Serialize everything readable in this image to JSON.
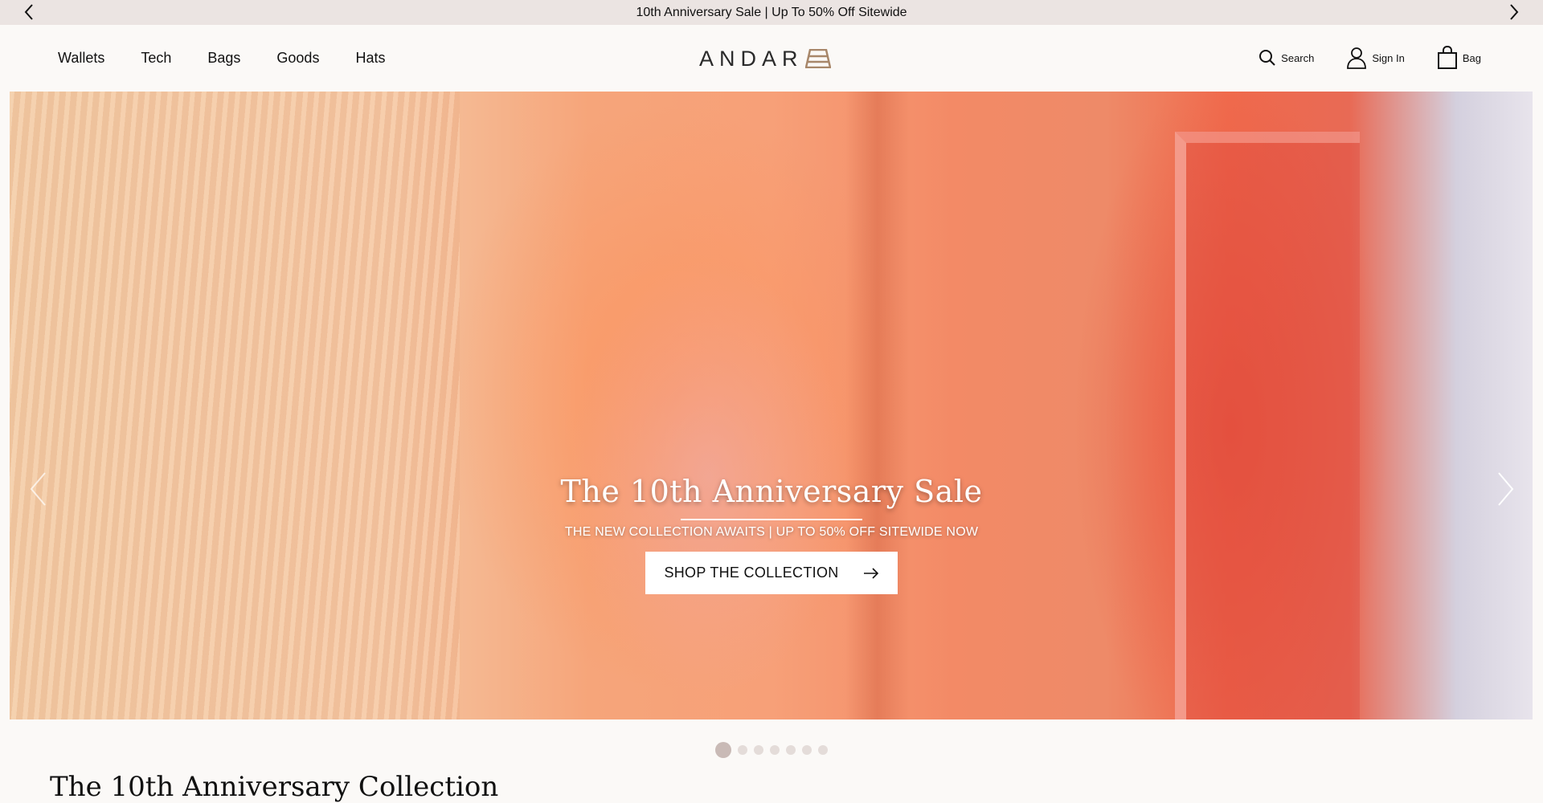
{
  "announcement": {
    "text": "10th Anniversary Sale | Up To 50% Off Sitewide",
    "prev_icon": "chevron-left-icon",
    "next_icon": "chevron-right-icon"
  },
  "nav": {
    "items": [
      {
        "label": "Wallets"
      },
      {
        "label": "Tech"
      },
      {
        "label": "Bags"
      },
      {
        "label": "Goods"
      },
      {
        "label": "Hats"
      }
    ]
  },
  "brand": {
    "name": "ANDAR"
  },
  "actions": {
    "search_label": "Search",
    "signin_label": "Sign In",
    "bag_label": "Bag"
  },
  "hero": {
    "title": "The 10th Anniversary Sale",
    "subtitle": "THE NEW COLLECTION AWAITS | UP TO 50% OFF SITEWIDE NOW",
    "cta_label": "SHOP THE COLLECTION"
  },
  "carousel": {
    "slide_count": 7,
    "active_index": 0
  },
  "section": {
    "title": "The 10th Anniversary Collection"
  },
  "colors": {
    "announcement_bg": "#ebe4e2",
    "page_bg": "#fbf9f7",
    "logo_accent": "#a8876a",
    "dot_active": "#c9bab6",
    "dot_inactive": "#e4dcd9"
  }
}
